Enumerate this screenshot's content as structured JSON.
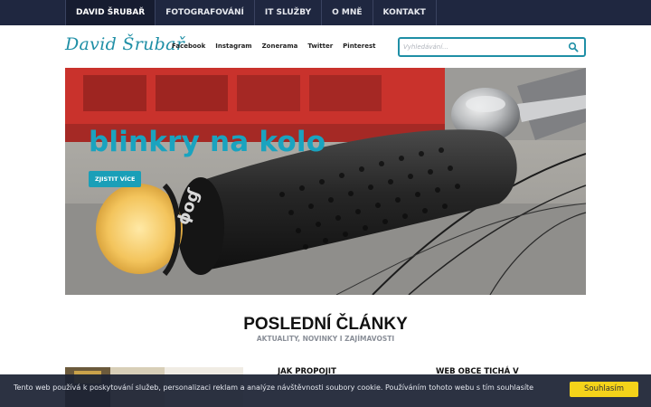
{
  "top_nav": {
    "items": [
      {
        "label": "DAVID ŠRUBAŘ"
      },
      {
        "label": "FOTOGRAFOVÁNÍ"
      },
      {
        "label": "IT SLUŽBY"
      },
      {
        "label": "O MNĚ"
      },
      {
        "label": "KONTAKT"
      }
    ]
  },
  "header": {
    "logo": "David  Šrubař",
    "social": [
      {
        "label": "Facebook"
      },
      {
        "label": "Instagram"
      },
      {
        "label": "Zonerama"
      },
      {
        "label": "Twitter"
      },
      {
        "label": "Pinterest"
      }
    ],
    "search": {
      "placeholder": "Vyhledávání...",
      "value": ""
    }
  },
  "hero": {
    "title": "blinkry na kolo",
    "button": "ZJISTIT VÍCE",
    "brand_mark": "ɸoɠ"
  },
  "articles_section": {
    "title": "POSLEDNÍ ČLÁNKY",
    "subtitle": "AKTUALITY, NOVINKY I ZAJÍMAVOSTI",
    "items": [
      {
        "title": "JAK PROPOJIT"
      },
      {
        "title": "WEB OBCE TICHÁ V"
      }
    ]
  },
  "cookie_bar": {
    "text": "Tento web používá k poskytování služeb, personalizaci reklam a analýze návštěvnosti soubory cookie. Používáním tohoto webu s tím souhlasíte",
    "button": "Souhlasím"
  },
  "colors": {
    "accent": "#1aa3bf",
    "nav_bg": "#1f2740",
    "cookie_button": "#f4d31a"
  }
}
